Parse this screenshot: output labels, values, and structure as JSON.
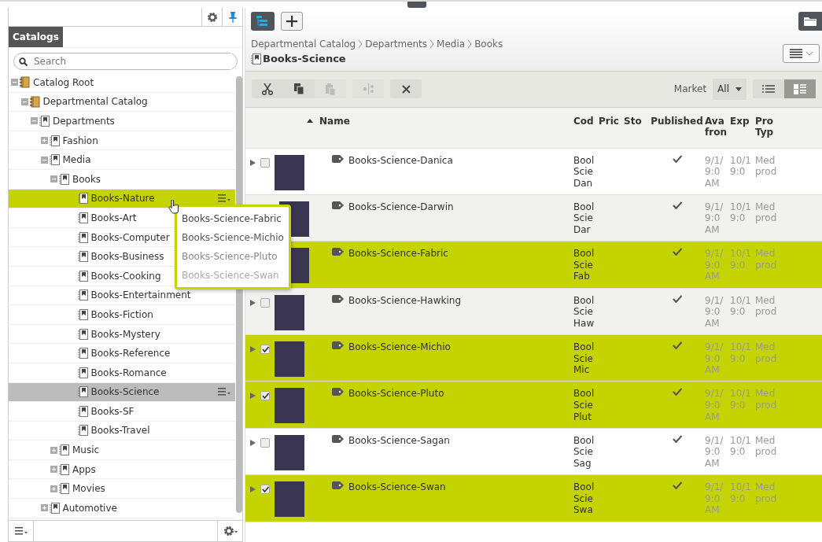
{
  "sidebar": {
    "tab": "Catalogs",
    "search": {
      "placeholder": "Search"
    },
    "tree": [
      {
        "label": "Catalog Root",
        "kind": "catalog",
        "expanded": true,
        "selected": false,
        "hovered": false,
        "children": [
          {
            "label": "Departmental Catalog",
            "kind": "catalog",
            "expanded": true,
            "selected": false,
            "hovered": false,
            "children": [
              {
                "label": "Departments",
                "kind": "node",
                "expanded": true,
                "selected": false,
                "hovered": false,
                "children": [
                  {
                    "label": "Fashion",
                    "kind": "node",
                    "expanded": false,
                    "selected": false,
                    "hovered": false
                  },
                  {
                    "label": "Media",
                    "kind": "node",
                    "expanded": true,
                    "selected": false,
                    "hovered": false,
                    "children": [
                      {
                        "label": "Books",
                        "kind": "node",
                        "expanded": true,
                        "selected": false,
                        "hovered": false,
                        "children": [
                          {
                            "label": "Books-Nature",
                            "kind": "leaf",
                            "selected": false,
                            "hovered": true
                          },
                          {
                            "label": "Books-Art",
                            "kind": "leaf",
                            "selected": false,
                            "hovered": false
                          },
                          {
                            "label": "Books-Computer",
                            "kind": "leaf",
                            "selected": false,
                            "hovered": false
                          },
                          {
                            "label": "Books-Business",
                            "kind": "leaf",
                            "selected": false,
                            "hovered": false
                          },
                          {
                            "label": "Books-Cooking",
                            "kind": "leaf",
                            "selected": false,
                            "hovered": false
                          },
                          {
                            "label": "Books-Entertainment",
                            "kind": "leaf",
                            "selected": false,
                            "hovered": false
                          },
                          {
                            "label": "Books-Fiction",
                            "kind": "leaf",
                            "selected": false,
                            "hovered": false
                          },
                          {
                            "label": "Books-Mystery",
                            "kind": "leaf",
                            "selected": false,
                            "hovered": false
                          },
                          {
                            "label": "Books-Reference",
                            "kind": "leaf",
                            "selected": false,
                            "hovered": false
                          },
                          {
                            "label": "Books-Romance",
                            "kind": "leaf",
                            "selected": false,
                            "hovered": false
                          },
                          {
                            "label": "Books-Science",
                            "kind": "leaf",
                            "selected": true,
                            "hovered": false
                          },
                          {
                            "label": "Books-SF",
                            "kind": "leaf",
                            "selected": false,
                            "hovered": false
                          },
                          {
                            "label": "Books-Travel",
                            "kind": "leaf",
                            "selected": false,
                            "hovered": false
                          }
                        ]
                      },
                      {
                        "label": "Music",
                        "kind": "node",
                        "expanded": false,
                        "selected": false,
                        "hovered": false
                      },
                      {
                        "label": "Apps",
                        "kind": "node",
                        "expanded": false,
                        "selected": false,
                        "hovered": false
                      },
                      {
                        "label": "Movies",
                        "kind": "node",
                        "expanded": false,
                        "selected": false,
                        "hovered": false
                      }
                    ]
                  },
                  {
                    "label": "Automotive",
                    "kind": "node",
                    "expanded": false,
                    "selected": false,
                    "hovered": false
                  }
                ]
              }
            ]
          }
        ]
      }
    ]
  },
  "drag_popup": {
    "items": [
      "Books-Science-Fabric",
      "Books-Science-Michio",
      "Books-Science-Pluto",
      "Books-Science-Swan"
    ]
  },
  "breadcrumb": [
    "Departmental Catalog",
    "Departments",
    "Media",
    "Books"
  ],
  "title": "Books-Science",
  "toolbar": {
    "market_label": "Market",
    "market_value": "All",
    "view_buttons": [
      {
        "kind": "list",
        "selected": false
      },
      {
        "kind": "tiles",
        "selected": true
      }
    ]
  },
  "table": {
    "sort_ascending": true,
    "columns": [
      [
        "Name"
      ],
      [
        "Cod"
      ],
      [
        "Pric"
      ],
      [
        "Sto"
      ],
      [
        "Published"
      ],
      [
        "Ava",
        "fron"
      ],
      [
        "Exp"
      ],
      [
        "Pro",
        "Typ"
      ]
    ],
    "rows": [
      {
        "name": "Books-Science-Danica",
        "checked": false,
        "selected": false,
        "published": true,
        "code": [
          "Bool",
          "Scie",
          "Dan"
        ],
        "available": [
          "9/1/",
          "9:0",
          "AM"
        ],
        "expires": [
          "10/1",
          "9:0"
        ],
        "type": [
          "Med",
          "prod"
        ]
      },
      {
        "name": "Books-Science-Darwin",
        "selected": false,
        "published": true,
        "code": [
          "Bool",
          "Scie",
          "Dar"
        ],
        "available": [
          "9/1/",
          "9:0",
          "AM"
        ],
        "expires": [
          "10/1",
          "9:0"
        ],
        "type": [
          "Med",
          "prod"
        ]
      },
      {
        "name": "Books-Science-Fabric",
        "selected": true,
        "published": true,
        "code": [
          "Bool",
          "Scie",
          "Fab"
        ],
        "available": [
          "9/1/",
          "9:0",
          "AM"
        ],
        "expires": [
          "10/1",
          "9:0"
        ],
        "type": [
          "Med",
          "prod"
        ]
      },
      {
        "name": "Books-Science-Hawking",
        "checked": false,
        "selected": false,
        "published": true,
        "code": [
          "Bool",
          "Scie",
          "Haw"
        ],
        "available": [
          "9/1/",
          "9:0",
          "AM"
        ],
        "expires": [
          "10/1",
          "9:0"
        ],
        "type": [
          "Med",
          "prod"
        ]
      },
      {
        "name": "Books-Science-Michio",
        "checked": true,
        "selected": true,
        "published": true,
        "code": [
          "Bool",
          "Scie",
          "Mic"
        ],
        "available": [
          "9/1/",
          "9:0",
          "AM"
        ],
        "expires": [
          "10/1",
          "9:0"
        ],
        "type": [
          "Med",
          "prod"
        ]
      },
      {
        "name": "Books-Science-Pluto",
        "checked": true,
        "selected": true,
        "published": true,
        "code": [
          "Bool",
          "Scie",
          "Plut"
        ],
        "available": [
          "9/1/",
          "9:0",
          "AM"
        ],
        "expires": [
          "10/1",
          "9:0"
        ],
        "type": [
          "Med",
          "prod"
        ]
      },
      {
        "name": "Books-Science-Sagan",
        "checked": false,
        "selected": false,
        "published": true,
        "code": [
          "Bool",
          "Scie",
          "Sag"
        ],
        "available": [
          "9/1/",
          "9:0",
          "AM"
        ],
        "expires": [
          "10/1",
          "9:0"
        ],
        "type": [
          "Med",
          "prod"
        ]
      },
      {
        "name": "Books-Science-Swan",
        "checked": true,
        "selected": true,
        "published": true,
        "code": [
          "Bool",
          "Scie",
          "Swa"
        ],
        "available": [
          "9/1/",
          "9:0",
          "AM"
        ],
        "expires": [
          "10/1",
          "9:0"
        ],
        "type": [
          "Med",
          "prod"
        ]
      }
    ]
  }
}
